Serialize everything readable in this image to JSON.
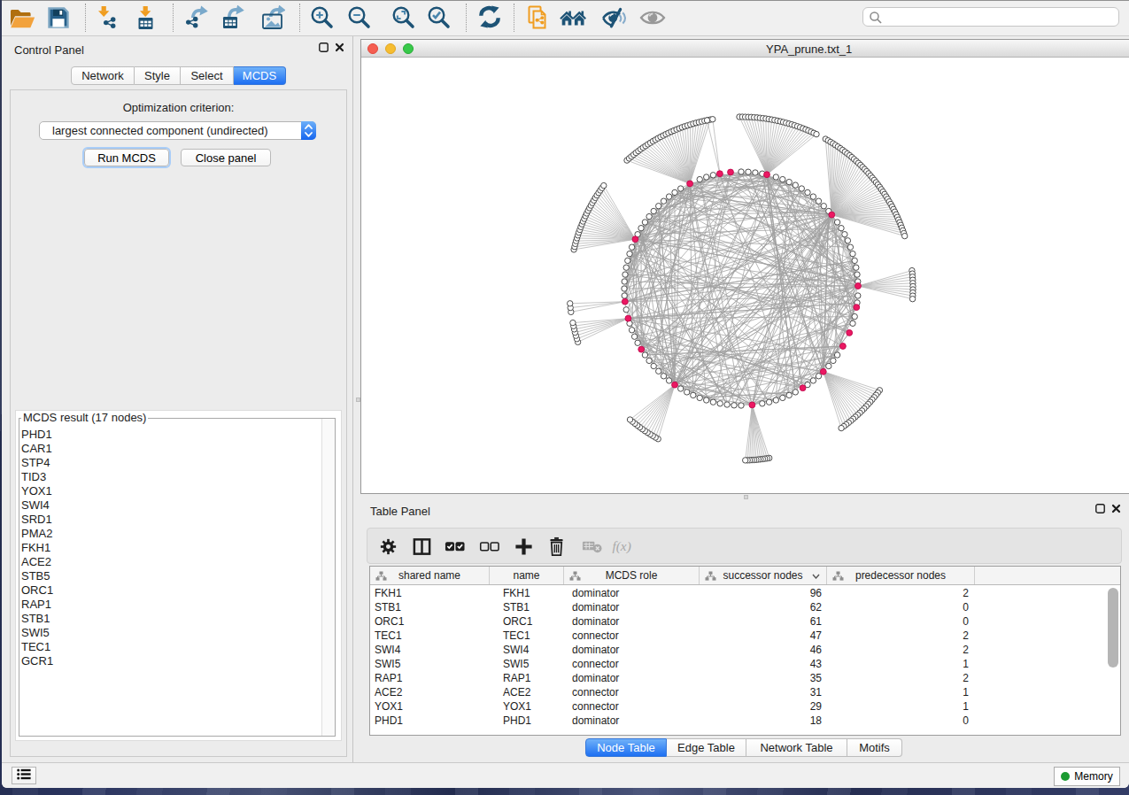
{
  "toolbar": {
    "icons": [
      "open-session",
      "save-session",
      "import-network",
      "import-table",
      "export-network",
      "export-table",
      "export-image",
      "zoom-in",
      "zoom-out",
      "zoom-fit",
      "zoom-selected",
      "refresh",
      "duplicate-network",
      "first-neighbors",
      "hide-selected",
      "show-all"
    ],
    "search": {
      "value": "",
      "placeholder": ""
    }
  },
  "control_panel": {
    "title": "Control Panel",
    "tabs": [
      {
        "label": "Network",
        "selected": false
      },
      {
        "label": "Style",
        "selected": false
      },
      {
        "label": "Select",
        "selected": false
      },
      {
        "label": "MCDS",
        "selected": true
      }
    ],
    "optimization_label": "Optimization criterion:",
    "dropdown_value": "largest connected component (undirected)",
    "run_button": "Run MCDS",
    "close_button": "Close panel",
    "result_title": "MCDS result (17 nodes)",
    "result_items": [
      "PHD1",
      "CAR1",
      "STP4",
      "TID3",
      "YOX1",
      "SWI4",
      "SRD1",
      "PMA2",
      "FKH1",
      "ACE2",
      "STB5",
      "ORC1",
      "RAP1",
      "STB1",
      "SWI5",
      "TEC1",
      "GCR1"
    ]
  },
  "network_view": {
    "title": "YPA_prune.txt_1"
  },
  "table_panel": {
    "title": "Table Panel",
    "toolbar_icons": [
      "settings",
      "column-layout",
      "select-all",
      "unselect-all",
      "add-column",
      "delete-column",
      "delete-table",
      "function-builder"
    ],
    "columns": [
      "shared name",
      "name",
      "MCDS role",
      "successor nodes",
      "predecessor nodes"
    ],
    "rows": [
      {
        "shared_name": "FKH1",
        "name": "FKH1",
        "role": "dominator",
        "succ": "96",
        "pred": "2"
      },
      {
        "shared_name": "STB1",
        "name": "STB1",
        "role": "dominator",
        "succ": "62",
        "pred": "0"
      },
      {
        "shared_name": "ORC1",
        "name": "ORC1",
        "role": "dominator",
        "succ": "61",
        "pred": "0"
      },
      {
        "shared_name": "TEC1",
        "name": "TEC1",
        "role": "connector",
        "succ": "47",
        "pred": "2"
      },
      {
        "shared_name": "SWI4",
        "name": "SWI4",
        "role": "dominator",
        "succ": "46",
        "pred": "2"
      },
      {
        "shared_name": "SWI5",
        "name": "SWI5",
        "role": "connector",
        "succ": "43",
        "pred": "1"
      },
      {
        "shared_name": "RAP1",
        "name": "RAP1",
        "role": "dominator",
        "succ": "35",
        "pred": "2"
      },
      {
        "shared_name": "ACE2",
        "name": "ACE2",
        "role": "connector",
        "succ": "31",
        "pred": "1"
      },
      {
        "shared_name": "YOX1",
        "name": "YOX1",
        "role": "connector",
        "succ": "29",
        "pred": "1"
      },
      {
        "shared_name": "PHD1",
        "name": "PHD1",
        "role": "dominator",
        "succ": "18",
        "pred": "0"
      }
    ],
    "bottom_tabs": [
      {
        "label": "Node Table",
        "selected": true
      },
      {
        "label": "Edge Table",
        "selected": false
      },
      {
        "label": "Network Table",
        "selected": false
      },
      {
        "label": "Motifs",
        "selected": false
      }
    ]
  },
  "status_bar": {
    "memory_label": "Memory"
  },
  "chart_data": {
    "type": "network-circular-layout",
    "center": [
      429,
      260
    ],
    "ring_radius": 132,
    "satellite_radius": 194,
    "ring_node_count": 104,
    "random_chords": 66,
    "band_chords": 34,
    "node_fill": "#ffffff",
    "node_stroke": "#4c4c4c",
    "hub_fill": "#ec1862",
    "hub_stroke": "#c40e52",
    "edge_color": "#8a8a8a",
    "leaf_edge_color": "#ababab",
    "hubs": [
      {
        "angle": -155.0,
        "leaves": 25,
        "chords": 18
      },
      {
        "angle": -116.0,
        "leaves": 33,
        "chords": 21
      },
      {
        "angle": -100.5,
        "leaves": 2,
        "chords": 10
      },
      {
        "angle": -95.2,
        "leaves": 0,
        "chords": 8
      },
      {
        "angle": -77.3,
        "leaves": 28,
        "chords": 18
      },
      {
        "angle": -39.2,
        "leaves": 45,
        "chords": 41
      },
      {
        "angle": -1.3,
        "leaves": 10,
        "chords": 26
      },
      {
        "angle": 9.2,
        "leaves": 0,
        "chords": 10
      },
      {
        "angle": 22.2,
        "leaves": 0,
        "chords": 7
      },
      {
        "angle": 29.5,
        "leaves": 0,
        "chords": 7
      },
      {
        "angle": 45.3,
        "leaves": 19,
        "chords": 16
      },
      {
        "angle": 58.2,
        "leaves": 0,
        "chords": 8
      },
      {
        "angle": 84.6,
        "leaves": 12,
        "span": 8,
        "chords": 20
      },
      {
        "angle": 124.6,
        "leaves": 12,
        "chords": 34
      },
      {
        "angle": 148.7,
        "leaves": 0,
        "chords": 8
      },
      {
        "angle": 165.2,
        "leaves": 7,
        "chords": 12
      },
      {
        "angle": 173.6,
        "leaves": 3,
        "chords": 10
      }
    ]
  }
}
